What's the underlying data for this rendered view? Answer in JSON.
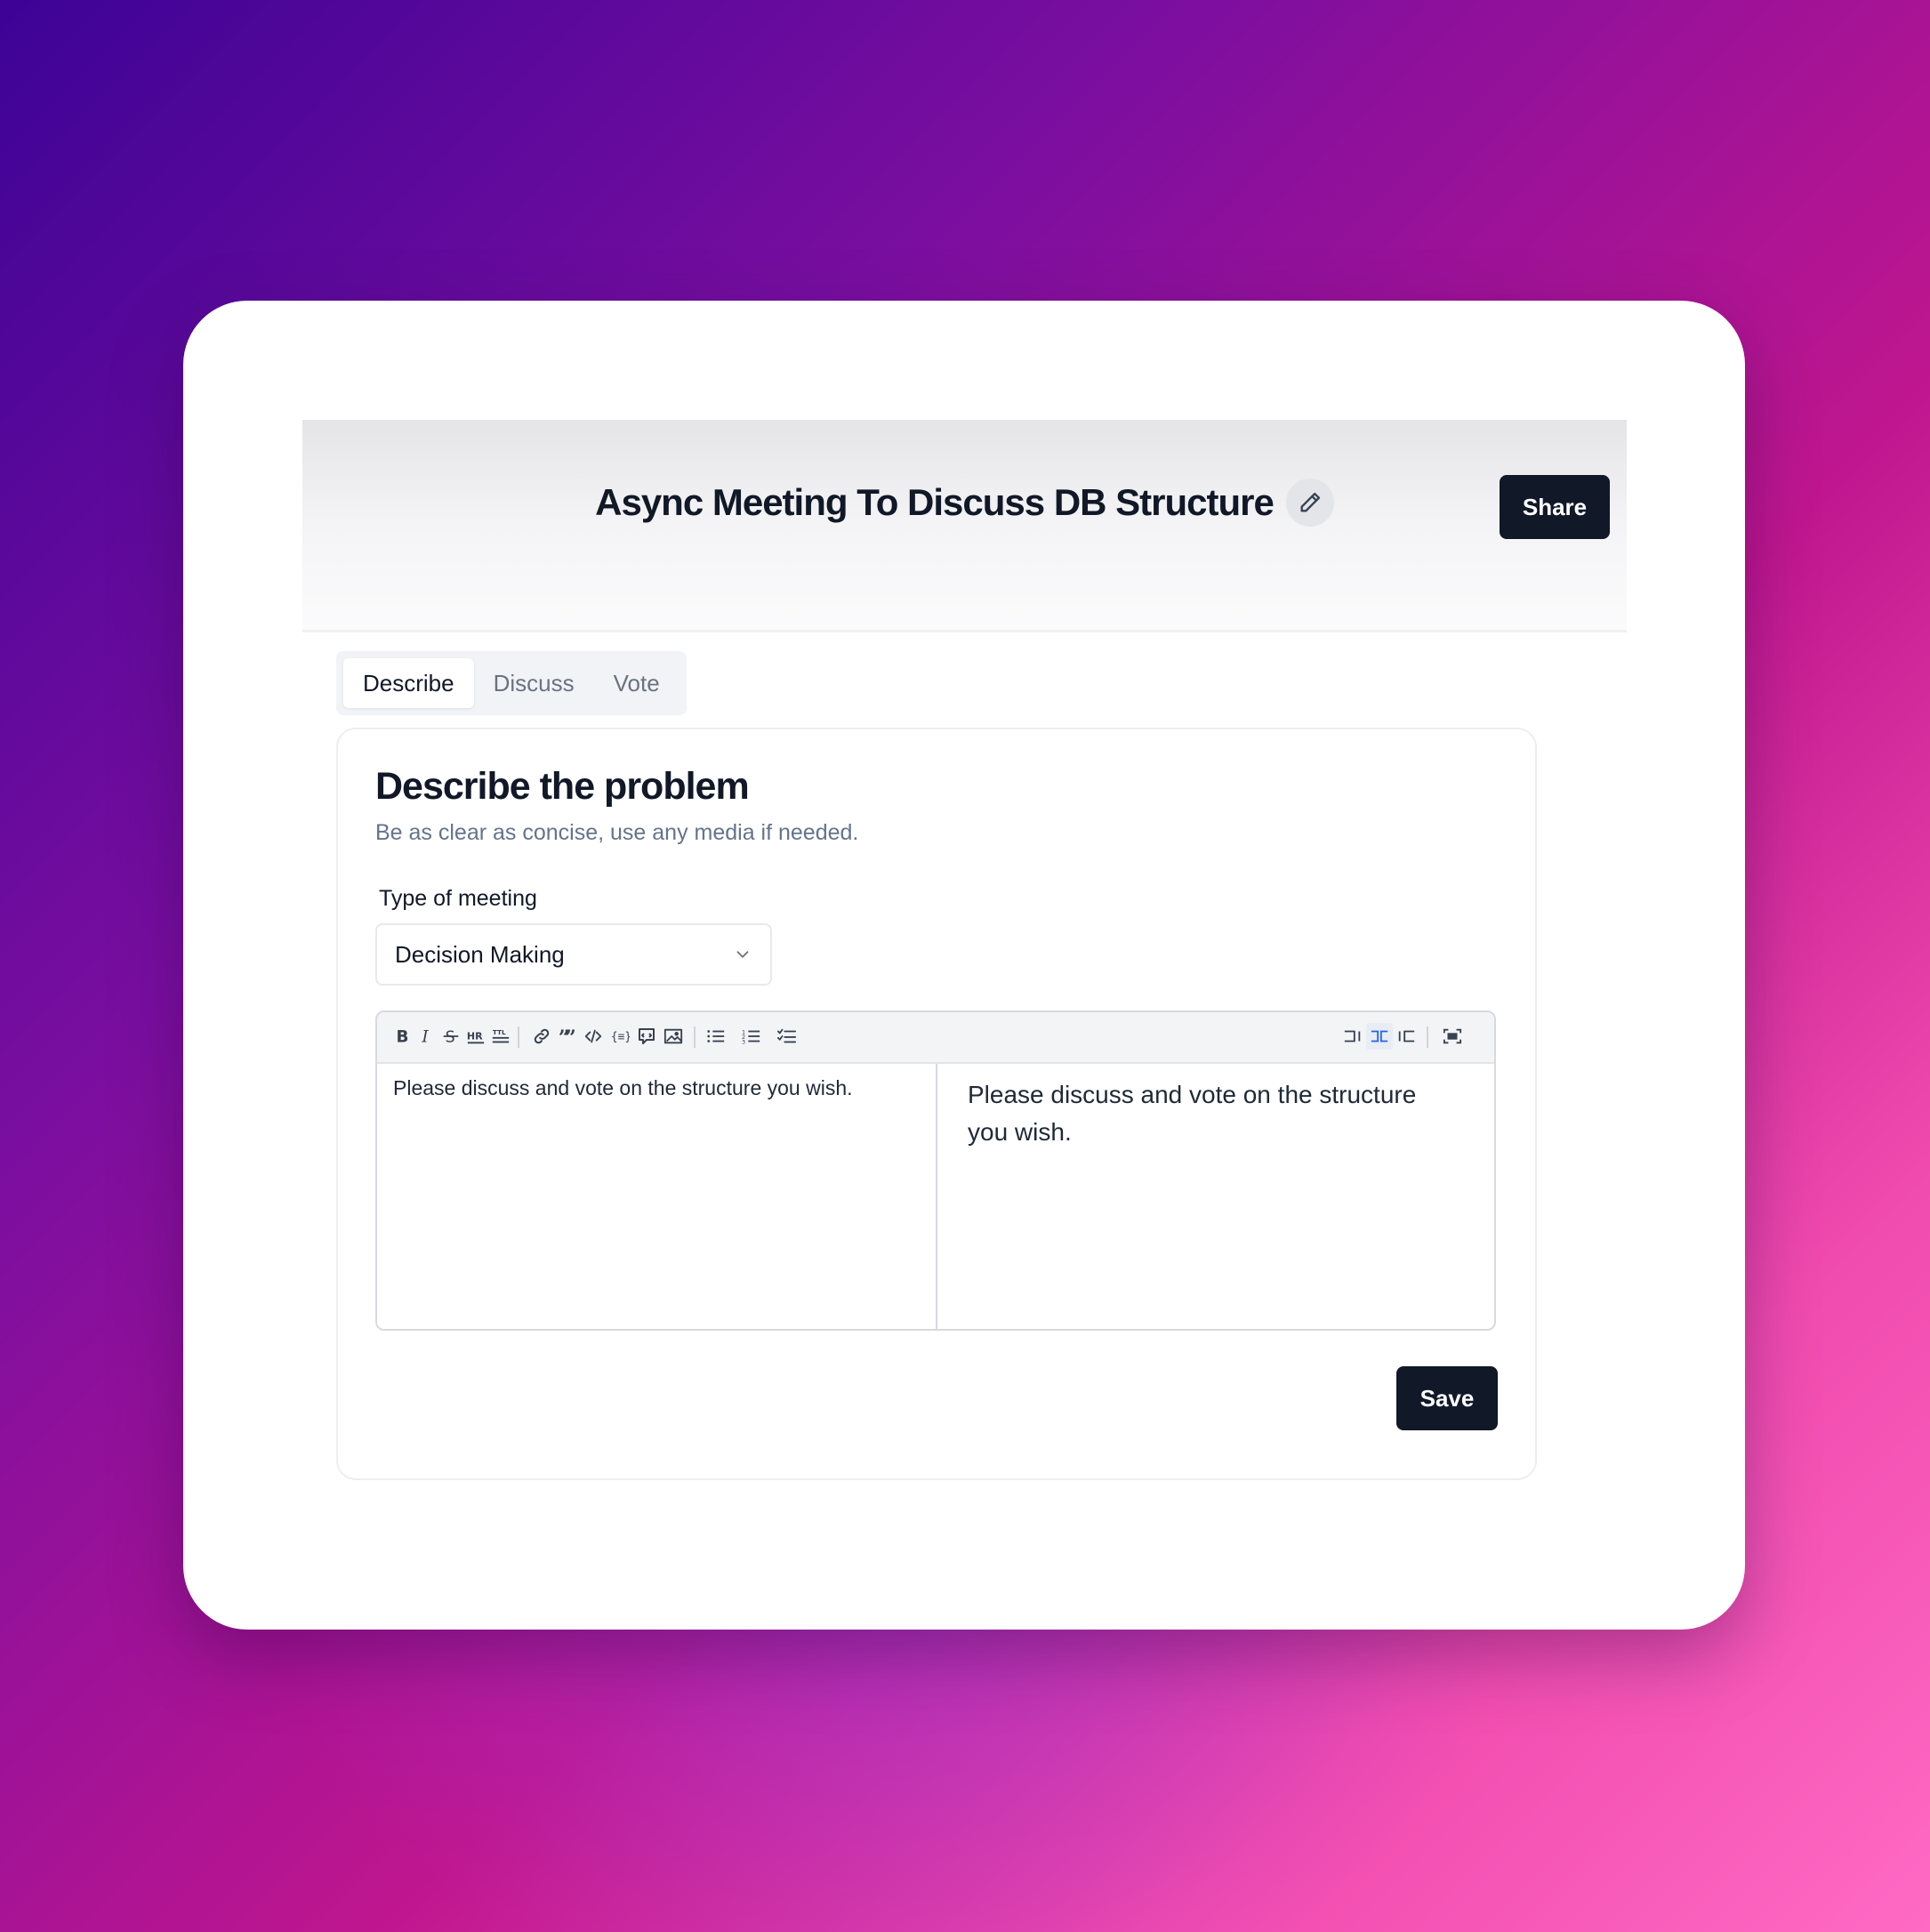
{
  "header": {
    "title": "Async Meeting To Discuss DB Structure",
    "share_label": "Share"
  },
  "tabs": [
    {
      "label": "Describe",
      "active": true
    },
    {
      "label": "Discuss",
      "active": false
    },
    {
      "label": "Vote",
      "active": false
    }
  ],
  "panel": {
    "title": "Describe the problem",
    "subtitle": "Be as clear as concise, use any media if needed.",
    "meeting_type_label": "Type of meeting",
    "meeting_type_value": "Decision Making",
    "save_label": "Save"
  },
  "editor": {
    "toolbar_icons": [
      "bold-icon",
      "italic-icon",
      "strikethrough-icon",
      "heading-icon",
      "heading-size-icon",
      "link-icon",
      "quote-icon",
      "code-icon",
      "code-block-icon",
      "comment-icon",
      "image-icon",
      "bullet-list-icon",
      "numbered-list-icon",
      "checklist-icon",
      "edit-mode-icon",
      "split-view-icon",
      "preview-mode-icon",
      "fullscreen-icon"
    ],
    "source_text": "Please discuss and vote on the structure you wish.",
    "preview_text": "Please discuss and vote on the structure you wish.",
    "active_view": "split"
  },
  "colors": {
    "primary_button": "#111827",
    "accent": "#2563eb"
  }
}
